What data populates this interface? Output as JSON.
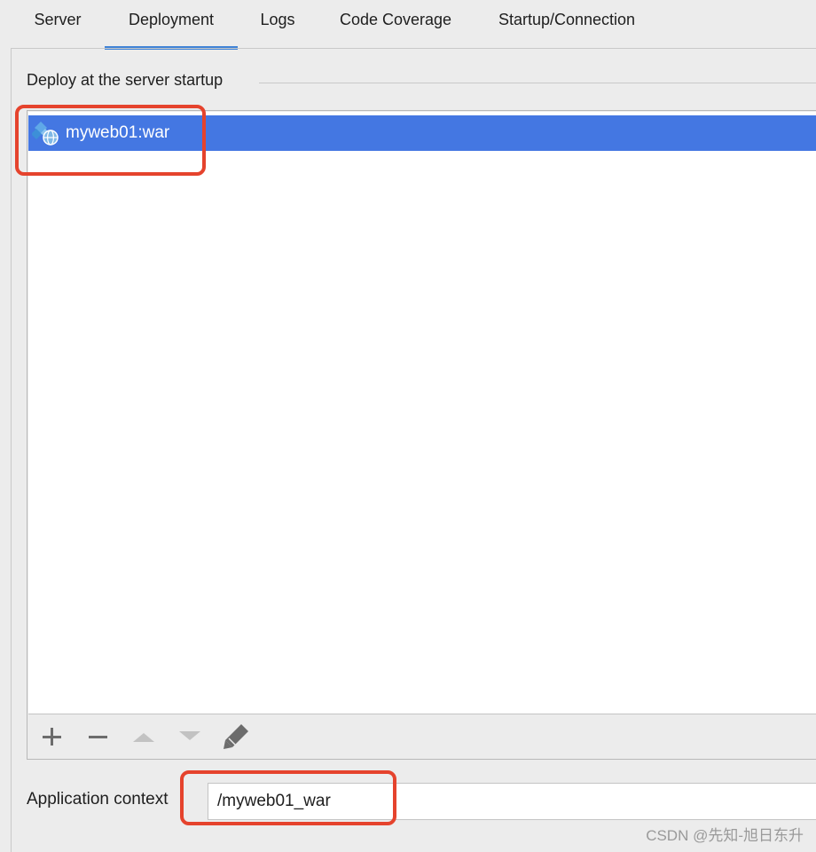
{
  "tabs": [
    {
      "label": "Server",
      "selected": false
    },
    {
      "label": "Deployment",
      "selected": true
    },
    {
      "label": "Logs",
      "selected": false
    },
    {
      "label": "Code Coverage",
      "selected": false
    },
    {
      "label": "Startup/Connection",
      "selected": false
    }
  ],
  "deploy_group": {
    "title": "Deploy at the server startup",
    "items": [
      {
        "label": "myweb01:war",
        "icon": "web-artifact-icon",
        "selected": true
      }
    ]
  },
  "toolbar": {
    "buttons": [
      {
        "icon": "add-icon",
        "enabled": true
      },
      {
        "icon": "remove-icon",
        "enabled": true
      },
      {
        "icon": "move-up-icon",
        "enabled": false
      },
      {
        "icon": "move-down-icon",
        "enabled": false
      },
      {
        "icon": "edit-pencil-icon",
        "enabled": true
      }
    ]
  },
  "application_context": {
    "label": "Application context",
    "value": "/myweb01_war"
  },
  "watermark": "CSDN @先知-旭日东升",
  "colors": {
    "accent": "#3f82d6",
    "selection": "#4477e2",
    "highlight": "#e5432d"
  }
}
